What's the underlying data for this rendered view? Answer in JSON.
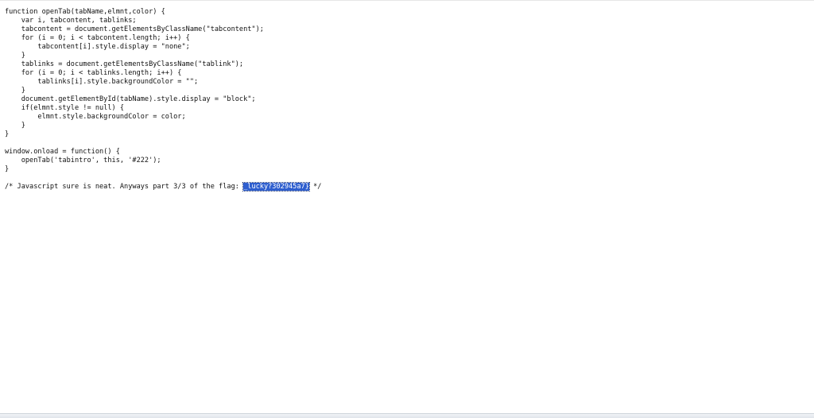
{
  "source": {
    "lines": [
      "function openTab(tabName,elmnt,color) {",
      "    var i, tabcontent, tablinks;",
      "    tabcontent = document.getElementsByClassName(\"tabcontent\");",
      "    for (i = 0; i < tabcontent.length; i++) {",
      "        tabcontent[i].style.display = \"none\";",
      "    }",
      "    tablinks = document.getElementsByClassName(\"tablink\");",
      "    for (i = 0; i < tablinks.length; i++) {",
      "        tablinks[i].style.backgroundColor = \"\";",
      "    }",
      "    document.getElementById(tabName).style.display = \"block\";",
      "    if(elmnt.style != null) {",
      "        elmnt.style.backgroundColor = color;",
      "    }",
      "}",
      "",
      "window.onload = function() {",
      "    openTab('tabintro', this, '#222');",
      "}",
      ""
    ],
    "comment_prefix": "/* Javascript sure is neat. Anyways part 3/3 of the flag: ",
    "selected_text": "_lucky?302945a7}",
    "comment_suffix": " */"
  },
  "colors": {
    "text": "#111111",
    "selection_background": "#2f5fcf",
    "selection_text": "#ffffff"
  }
}
